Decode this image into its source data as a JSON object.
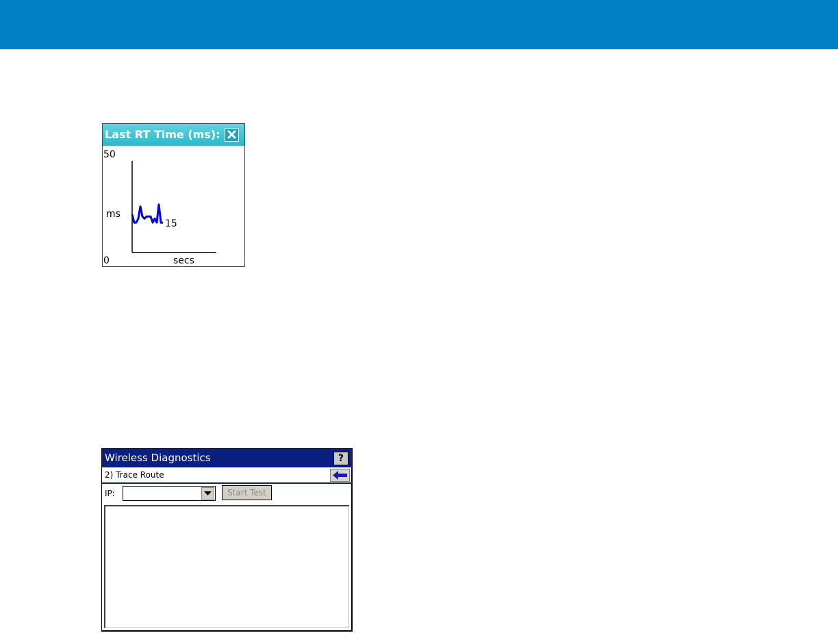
{
  "colors": {
    "top_bar": "#0080c6",
    "rt_title_bg": "#2cb8c8",
    "rt_series": "#0000e0",
    "wd_title_bg": "#0a1f80"
  },
  "rt_window": {
    "title": "Last RT Time (ms):",
    "close_icon": "close-icon"
  },
  "chart_data": {
    "type": "line",
    "y_max_label": "50",
    "y_min_label": "0",
    "ylabel": "ms",
    "xlabel": "secs",
    "ylim": [
      0,
      50
    ],
    "last_value_label": "15",
    "series": [
      {
        "values": [
          19,
          15,
          15,
          17,
          23,
          18,
          17,
          18,
          18,
          18,
          15,
          17,
          15,
          24,
          15,
          15
        ]
      }
    ]
  },
  "wd_window": {
    "title": "Wireless Diagnostics",
    "help_label": "?",
    "section": "2) Trace Route",
    "back_icon": "back-arrow-icon",
    "ip_label": "IP:",
    "ip_value": "",
    "start_button": "Start Test"
  }
}
